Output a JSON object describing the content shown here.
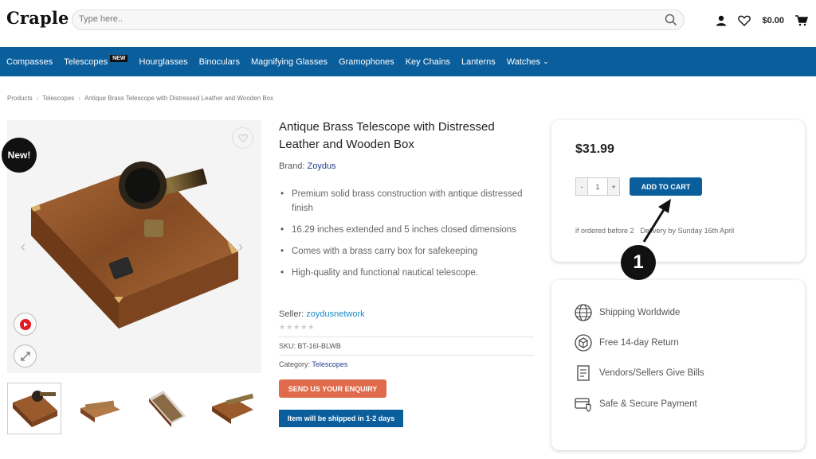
{
  "header": {
    "logo": "Craple",
    "search_placeholder": "Type here..",
    "cart_total": "$0.00"
  },
  "nav": {
    "items": [
      {
        "label": "Compasses"
      },
      {
        "label": "Telescopes",
        "badge": "NEW"
      },
      {
        "label": "Hourglasses"
      },
      {
        "label": "Binoculars"
      },
      {
        "label": "Magnifying Glasses"
      },
      {
        "label": "Gramophones"
      },
      {
        "label": "Key Chains"
      },
      {
        "label": "Lanterns"
      },
      {
        "label": "Watches"
      }
    ]
  },
  "breadcrumb": [
    "Products",
    "Telescopes",
    "Antique Brass Telescope with Distressed Leather and Wooden Box"
  ],
  "gallery": {
    "badge": "New!"
  },
  "product": {
    "title": "Antique Brass Telescope with Distressed Leather and Wooden Box",
    "brand_label": "Brand:",
    "brand": "Zoydus",
    "features": [
      "Premium solid brass construction with antique distressed finish",
      "16.29 inches extended and 5 inches closed dimensions",
      "Comes with a brass carry box for safekeeping",
      "High-quality and functional nautical telescope."
    ],
    "seller_label": "Seller:",
    "seller": "zoydusnetwork",
    "sku_label": "SKU:",
    "sku": "BT-16I-BLWB",
    "category_label": "Category:",
    "category": "Telescopes",
    "enquiry_button": "SEND US YOUR ENQUIRY",
    "shipping_tag": "Item will be shipped in 1-2 days"
  },
  "purchase": {
    "price": "$31.99",
    "qty_minus": "-",
    "qty_value": "1",
    "qty_plus": "+",
    "add_to_cart": "ADD TO CART",
    "delivery_left": "if ordered before 2",
    "delivery_right": "Delivery by Sunday 16th April"
  },
  "annotation": {
    "step": "1"
  },
  "benefits": [
    {
      "label": "Shipping Worldwide",
      "icon": "globe-icon"
    },
    {
      "label": "Free 14-day Return",
      "icon": "return-box-icon"
    },
    {
      "label": "Vendors/Sellers Give Bills",
      "icon": "invoice-icon"
    },
    {
      "label": "Safe & Secure Payment",
      "icon": "secure-card-icon"
    }
  ]
}
